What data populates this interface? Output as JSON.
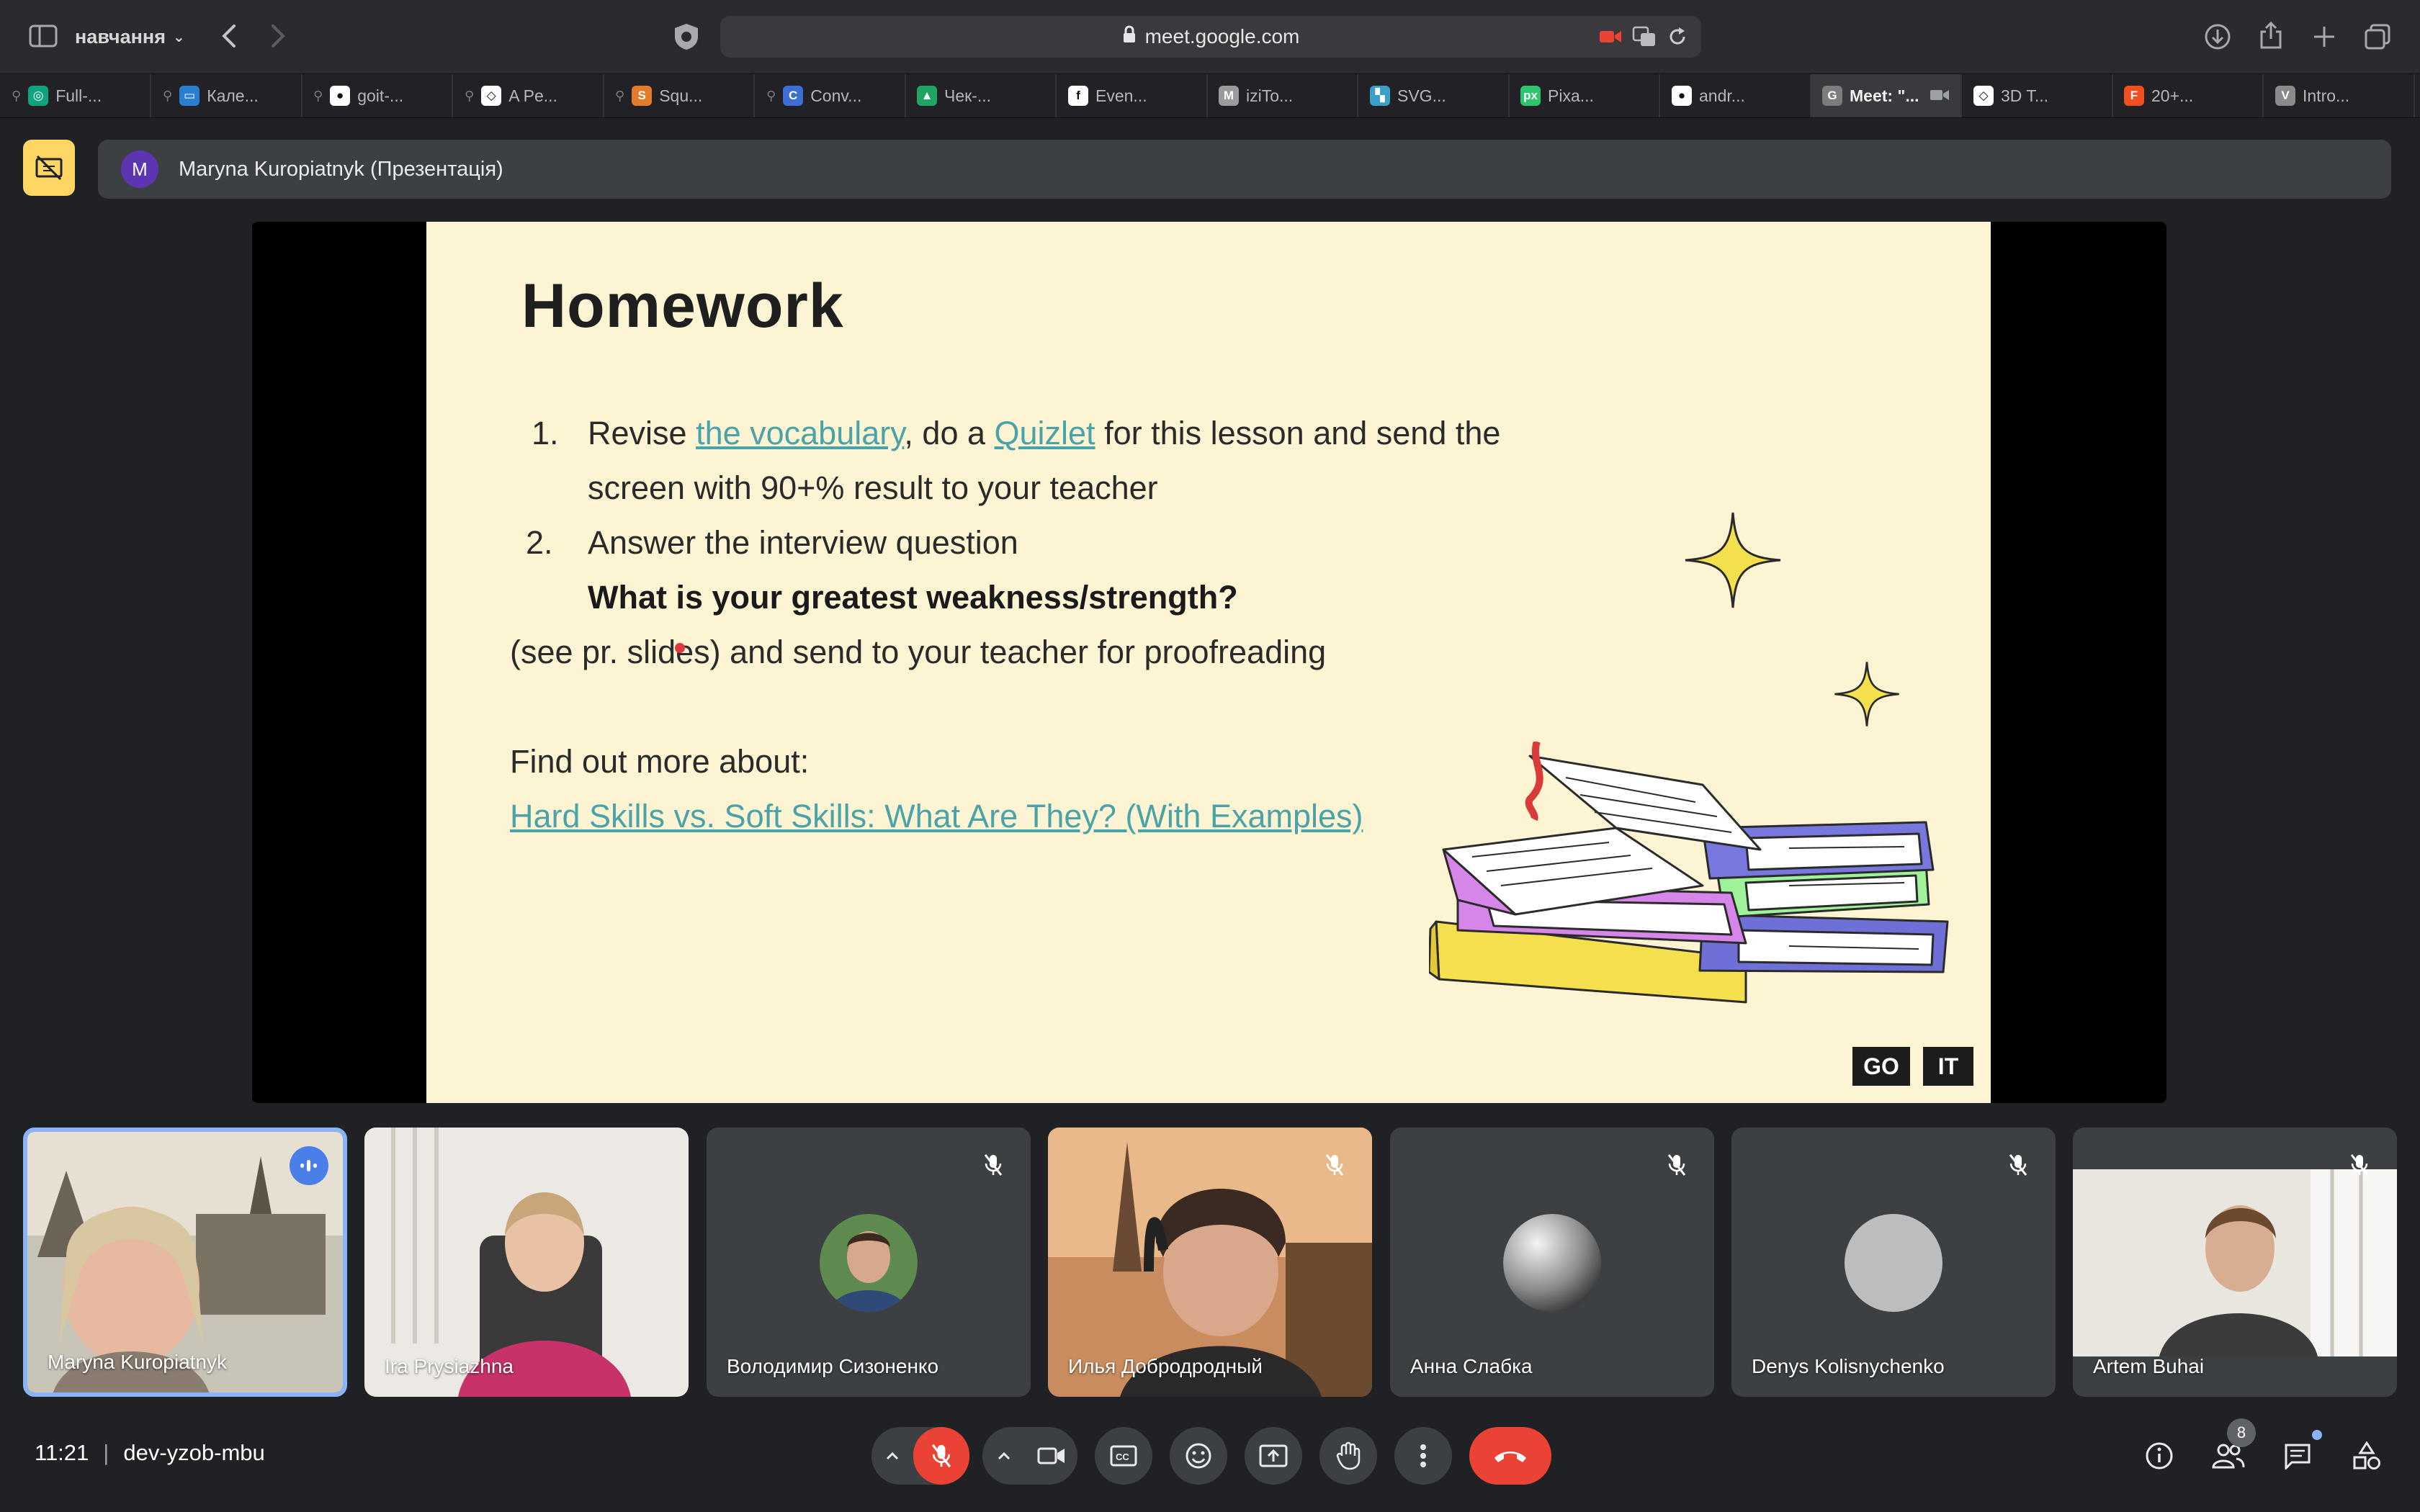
{
  "browser": {
    "tab_group": "навчання",
    "url": "meet.google.com",
    "tabs": [
      {
        "label": "Full-...",
        "pinned": true,
        "fav_color": "#10a37f",
        "fav_text": "◎"
      },
      {
        "label": "Кале...",
        "pinned": true,
        "fav_color": "#2b7fd3",
        "fav_text": "▭"
      },
      {
        "label": "goit-...",
        "pinned": true,
        "fav_color": "#ffffff",
        "fav_text": "●"
      },
      {
        "label": "A Pe...",
        "pinned": true,
        "fav_color": "#ffffff",
        "fav_text": "◇"
      },
      {
        "label": "Squ...",
        "pinned": true,
        "fav_color": "#e37b2b",
        "fav_text": "S"
      },
      {
        "label": "Conv...",
        "pinned": true,
        "fav_color": "#3b6fd6",
        "fav_text": "C"
      },
      {
        "label": "Чек-...",
        "pinned": false,
        "fav_color": "#1fa463",
        "fav_text": "▲"
      },
      {
        "label": "Even...",
        "pinned": false,
        "fav_color": "#ffffff",
        "fav_text": "f"
      },
      {
        "label": "iziTo...",
        "pinned": false,
        "fav_color": "#9b9b9b",
        "fav_text": "M"
      },
      {
        "label": "SVG...",
        "pinned": false,
        "fav_color": "#3aa0c8",
        "fav_text": "▚"
      },
      {
        "label": "Pixa...",
        "pinned": false,
        "fav_color": "#2ec66d",
        "fav_text": "px"
      },
      {
        "label": "andr...",
        "pinned": false,
        "fav_color": "#ffffff",
        "fav_text": "●"
      },
      {
        "label": "Meet: \"...",
        "pinned": false,
        "fav_color": "#7d7d7d",
        "fav_text": "G",
        "active": true
      },
      {
        "label": "3D T...",
        "pinned": false,
        "fav_color": "#ffffff",
        "fav_text": "◇"
      },
      {
        "label": "20+...",
        "pinned": false,
        "fav_color": "#f24e1e",
        "fav_text": "F"
      },
      {
        "label": "Intro...",
        "pinned": false,
        "fav_color": "#8a8a8a",
        "fav_text": "V"
      }
    ]
  },
  "meet": {
    "presenter_initial": "M",
    "presenter_label": "Maryna Kuropiatnyk (Презентація)",
    "time": "11:21",
    "separator": "|",
    "meeting_code": "dev-yzob-mbu",
    "participants_count": "8"
  },
  "slide": {
    "title": "Homework",
    "item1_num": "1.",
    "item1_a": "Revise ",
    "item1_link1": "the vocabulary",
    "item1_b": ", do a ",
    "item1_link2": "Quizlet",
    "item1_c": " for this lesson and send the",
    "item1_line2": "screen with 90+% result to your teacher",
    "item2_num": "2.",
    "item2": "Answer the interview question",
    "question": "What is your greatest weakness/strength?",
    "note": "(see pr. slides) and send to your teacher for proofreading",
    "find_more": "Find out more about:",
    "article_link": "Hard Skills vs. Soft Skills: What Are They? (With Examples)",
    "logo_left": "GO",
    "logo_right": "IT"
  },
  "participants": [
    {
      "name": "Maryna Kuropiatnyk",
      "speaking": true
    },
    {
      "name": "Ira Prysiazhna",
      "muted": false
    },
    {
      "name": "Володимир Сизоненко",
      "muted": true
    },
    {
      "name": "Илья Добродродный",
      "muted": true
    },
    {
      "name": "Анна Слабка",
      "muted": true
    },
    {
      "name": "Denys Kolisnychenko",
      "muted": true
    },
    {
      "name": "Artem Buhai",
      "muted": true
    }
  ]
}
